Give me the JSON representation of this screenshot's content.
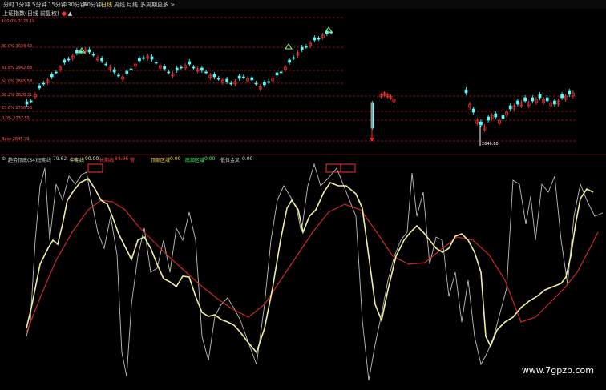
{
  "period_tabs": [
    "分时",
    "1分钟",
    "5分钟",
    "15分钟",
    "30分钟",
    "60分钟",
    "日线",
    "周线",
    "月线",
    "多周期",
    "更多 >"
  ],
  "active_tab_index": 6,
  "main_chart": {
    "title": "上证指数(日线 前复权)",
    "hide_icon": "up-triangle-icon",
    "price_levels": [
      "100.0% 3125.19",
      "80.0% 3034.42",
      "61.8% 2942.88",
      "50.0% 2865.58",
      "38.2% 2828.31",
      "23.6% 2758.56",
      "0.0% 2737.55",
      "Base 2645.79"
    ],
    "low_marker": "2646.80"
  },
  "indicator": {
    "name": "趋势顶底(34)",
    "short_label": "短期线",
    "short_value": "79.62",
    "mid_label": "中期线",
    "mid_value": "90.00",
    "long_label": "长期线",
    "long_value": "84.96",
    "extra_label": "警",
    "top_zone_label": "顶部区域",
    "top_zone_value": "0.00",
    "bottom_zone_label": "底部区域",
    "bottom_zone_value": "0.00",
    "golden_cross_label": "低位金叉",
    "golden_cross_value": "0.00"
  },
  "watermark": "www.7gpzb.com",
  "colors": {
    "background": "#000000",
    "up_candle": "#ff3b3b",
    "down_candle": "#54ffff",
    "level_line": "#c02020",
    "short_line": "#bdbdbd",
    "mid_line": "#f2f0a0",
    "long_line": "#c82828",
    "active_tab": "#ffd84a"
  }
}
